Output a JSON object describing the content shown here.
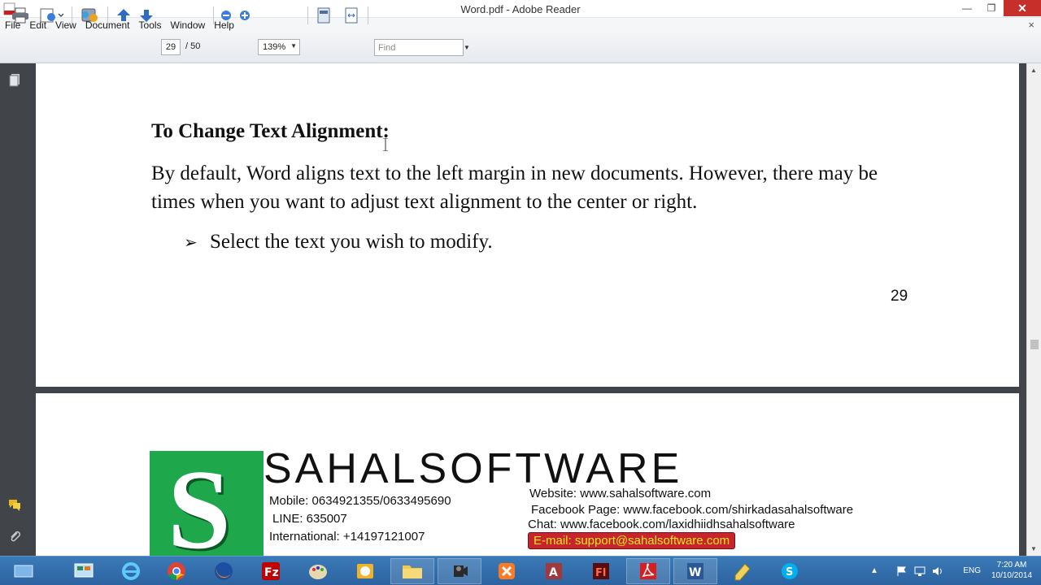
{
  "window": {
    "title": "Word.pdf - Adobe Reader",
    "minimize": "—",
    "restore": "❐",
    "close": "✕"
  },
  "menu": [
    "File",
    "Edit",
    "View",
    "Document",
    "Tools",
    "Window",
    "Help"
  ],
  "menu_close": "×",
  "toolbar": {
    "page_current": "29",
    "page_total": "/ 50",
    "zoom": "139%",
    "find_placeholder": "Find"
  },
  "page1": {
    "heading": "To Change Text Alignment:",
    "paragraph": "By default, Word aligns text to the left margin in new documents. However, there may be times when you want to adjust text alignment to the center or right.",
    "bullet_marker": "➢",
    "bullet": "Select the text you wish to modify.",
    "page_number": "29"
  },
  "banner": {
    "logo_letter": "S",
    "brand": "SAHALSOFTWARE",
    "mobile": "Mobile: 0634921355/0633495690",
    "line": "LINE: 635007",
    "international": "International: +14197121007",
    "website": "Website: www.sahalsoftware.com",
    "facebook": "Facebook Page: www.facebook.com/shirkadasahalsoftware",
    "chat": "Chat: www.facebook.com/laxidhiidhsahalsoftware",
    "email": "E-mail: support@sahalsoftware.com"
  },
  "tray": {
    "lang": "ENG",
    "time": "7:20 AM",
    "date": "10/10/2014"
  },
  "colors": {
    "logo_green": "#1fa84b",
    "email_red": "#c7252b",
    "viewer_bg": "#414448",
    "taskbar": "#2c63a0"
  }
}
